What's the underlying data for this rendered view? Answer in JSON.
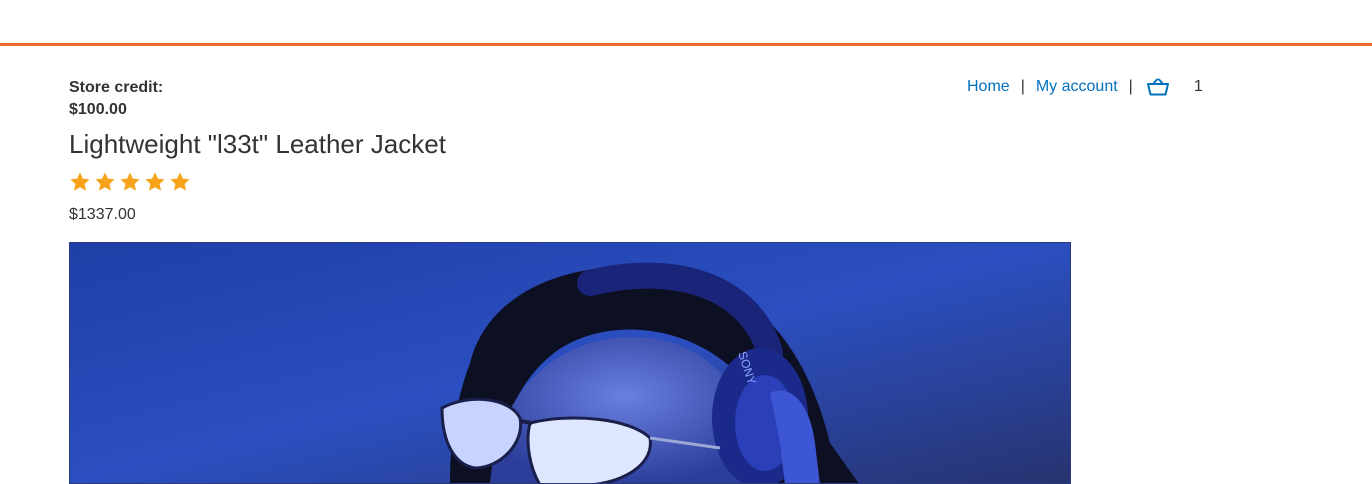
{
  "colors": {
    "accent": "#e96e2c",
    "link": "#0071bc",
    "star": "#f7a31c",
    "text": "#333333"
  },
  "header": {
    "store_credit_label": "Store credit:",
    "store_credit_value": "$100.00"
  },
  "nav": {
    "home_label": "Home",
    "separator": "|",
    "account_label": "My account",
    "cart_icon": "basket-icon",
    "cart_count": "1"
  },
  "product": {
    "title": "Lightweight \"l33t\" Leather Jacket",
    "rating": 5,
    "rating_max": 5,
    "price": "$1337.00",
    "image_brand_text": "SONY"
  }
}
